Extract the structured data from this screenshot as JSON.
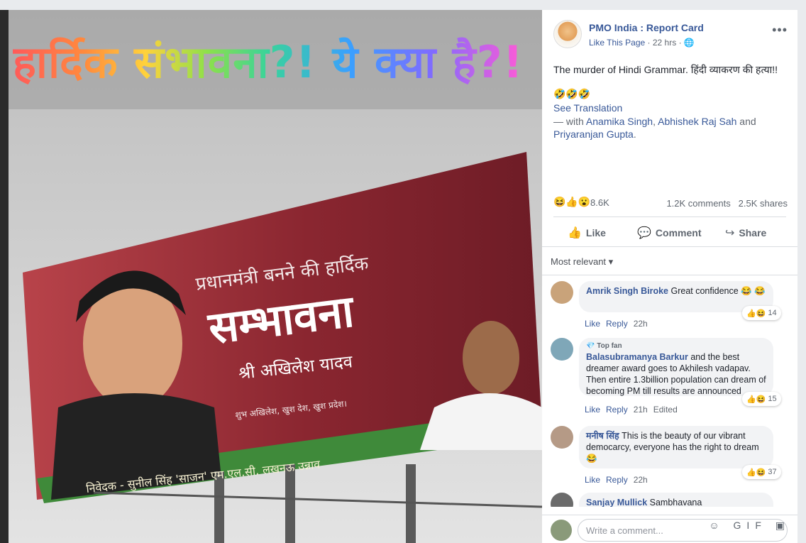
{
  "overlay_title": "हार्दिक संभावना?! ये क्या है?!",
  "billboard": {
    "line1": "प्रधानमंत्री बनने की हार्दिक",
    "line2": "सम्भावना",
    "line3": "श्री अखिलेश यादव",
    "line4": "शुभ अखिलेश, खुश देश, खुश प्रदेश।",
    "footer": "निवेदक - सुनील सिंह 'साजन' एम.एल.सी. लखनऊ   उन्नाव"
  },
  "post": {
    "page_name": "PMO India : Report Card",
    "like_page": "Like This Page",
    "time": "22 hrs",
    "caption": "The murder of Hindi Grammar. हिंदी व्याकरण की हत्या!!",
    "caption_emoji": "🤣🤣🤣",
    "see_translation": "See Translation",
    "with_prefix": "— with",
    "tag1": "Anamika Singh",
    "tag2": "Abhishek Raj Sah",
    "and": "and",
    "tag3": "Priyaranjan Gupta",
    "period": ".",
    "react_emojis": "😆👍😮",
    "react_count": "8.6K",
    "comments_count": "1.2K comments",
    "shares_count": "2.5K shares",
    "more": "•••"
  },
  "actions": {
    "like": "Like",
    "comment": "Comment",
    "share": "Share"
  },
  "sort": "Most relevant",
  "comments": [
    {
      "name": "Amrik Singh Biroke",
      "text": "Great confidence 😂 😂",
      "like": "Like",
      "reply": "Reply",
      "time": "22h",
      "badge_icons": "👍😆",
      "badge_count": "14"
    },
    {
      "topfan": "💎 Top fan",
      "name": "Balasubramanya Barkur",
      "text": "and the best dreamer award goes to Akhilesh vadapav. Then entire 1.3billion population can dream of becoming PM till results are announced",
      "like": "Like",
      "reply": "Reply",
      "time": "21h",
      "edited": "Edited",
      "badge_icons": "👍😆",
      "badge_count": "15"
    },
    {
      "name": "मनीष सिंह",
      "text": "This is the beauty of our vibrant democarcy, everyone has the right to dream 😂",
      "like": "Like",
      "reply": "Reply",
      "time": "22h",
      "badge_icons": "👍😆",
      "badge_count": "37"
    },
    {
      "name": "Sanjay Mullick",
      "text": "Sambhavana"
    }
  ],
  "composer": {
    "placeholder": "Write a comment...",
    "icons": "☺ GIF ▣"
  }
}
